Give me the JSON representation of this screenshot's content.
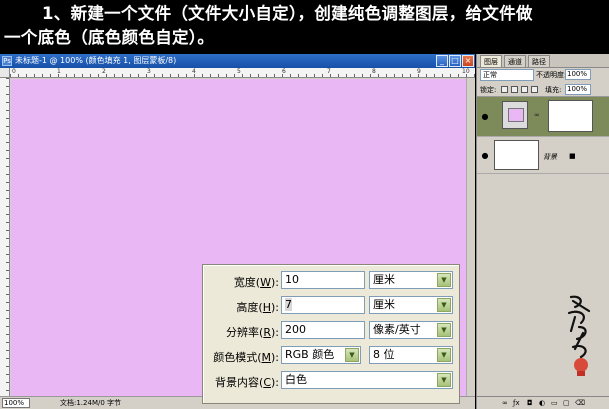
{
  "heading": {
    "line1": "1、新建一个文件（文件大小自定），创建纯色调整图层，给文件做",
    "line2": "一个底色（底色颜色自定）。"
  },
  "document": {
    "title": "未标题-1 @ 100% (颜色填充 1, 图层蒙板/8)",
    "canvas_color": "#e8b7f4",
    "ruler_numbers": [
      "0",
      "1",
      "2",
      "3",
      "4",
      "5",
      "6",
      "7",
      "8",
      "9",
      "10"
    ],
    "status": {
      "zoom": "100%",
      "doc_info": "文档:1.24M/0 字节"
    }
  },
  "dialog": {
    "width": {
      "label": "宽度(",
      "key": "W",
      "end": "):",
      "value": "10",
      "unit": "厘米"
    },
    "height": {
      "label": "高度(",
      "key": "H",
      "end": "):",
      "value": "7",
      "unit": "厘米"
    },
    "resolution": {
      "label": "分辨率(",
      "key": "R",
      "end": "):",
      "value": "200",
      "unit": "像素/英寸"
    },
    "color_mode": {
      "label": "颜色模式(",
      "key": "M",
      "end": "):",
      "value": "RGB 颜色",
      "bits": "8 位"
    },
    "background": {
      "label": "背景内容(",
      "key": "C",
      "end": "):",
      "value": "白色"
    }
  },
  "layers_panel": {
    "tabs": [
      "图层",
      "通道",
      "路径"
    ],
    "blend_mode": "正常",
    "opacity_label": "不透明度:",
    "opacity_value": "100%",
    "lock_label": "锁定:",
    "fill_label": "填充:",
    "fill_value": "100%",
    "bg_layer_name": "背景"
  }
}
